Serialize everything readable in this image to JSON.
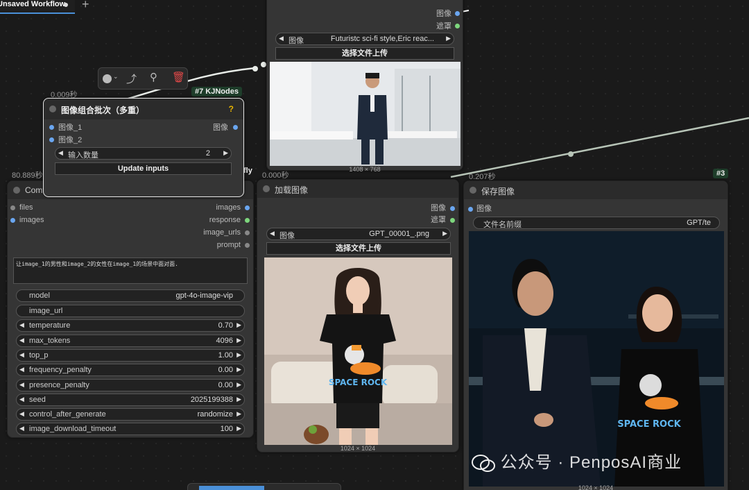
{
  "tab": {
    "title": "Unsaved Workflow",
    "plus": "+"
  },
  "node_combine": {
    "time": "0.009秒",
    "badge": "#7 KJNodes",
    "title": "图像组合批次（多重）",
    "help": "?",
    "in1": "图像_1",
    "in2": "图像_2",
    "out": "图像",
    "count_label": "输入数量",
    "count_value": "2",
    "update_btn": "Update inputs"
  },
  "node_top_load": {
    "out1": "图像",
    "out2": "遮罩",
    "image_label": "图像",
    "image_value": "Futuristc sci-fi style,Eric reac...",
    "upload_btn": "选择文件上传",
    "dims": "1408 × 768"
  },
  "node_api": {
    "time": "80.889秒",
    "title": "Comf",
    "partial_right": "fly",
    "in_files": "files",
    "in_images": "images",
    "out_images": "images",
    "out_response": "response",
    "out_image_urls": "image_urls",
    "out_prompt": "prompt",
    "prompt_text": "让image_1的男性和image_2的女性在image_1的场景中面对面.",
    "widgets": [
      {
        "label": "model",
        "value": "gpt-4o-image-vip"
      },
      {
        "label": "image_url",
        "value": ""
      },
      {
        "label": "temperature",
        "value": "0.70"
      },
      {
        "label": "max_tokens",
        "value": "4096"
      },
      {
        "label": "top_p",
        "value": "1.00"
      },
      {
        "label": "frequency_penalty",
        "value": "0.00"
      },
      {
        "label": "presence_penalty",
        "value": "0.00"
      },
      {
        "label": "seed",
        "value": "2025199388"
      },
      {
        "label": "control_after_generate",
        "value": "randomize"
      },
      {
        "label": "image_download_timeout",
        "value": "100"
      }
    ]
  },
  "node_load2": {
    "time": "0.000秒",
    "title": "加载图像",
    "out1": "图像",
    "out2": "遮罩",
    "image_label": "图像",
    "image_value": "GPT_00001_.png",
    "upload_btn": "选择文件上传",
    "dims": "1024 × 1024",
    "shirt_text": "SPACE ROCK"
  },
  "node_save": {
    "time": "0.207秒",
    "badge": "#3",
    "title": "保存图像",
    "in": "图像",
    "prefix_label": "文件名前缀",
    "prefix_value": "GPT/te",
    "dims": "1024 × 1024",
    "shirt_text": "SPACE ROCK"
  },
  "watermark": "公众号 · PenposAI商业",
  "colors": {
    "wire": "#cfd8cf",
    "port_blue": "#6aa6f0",
    "port_green": "#7dd67d",
    "badge_bg": "#1e3d2a"
  }
}
